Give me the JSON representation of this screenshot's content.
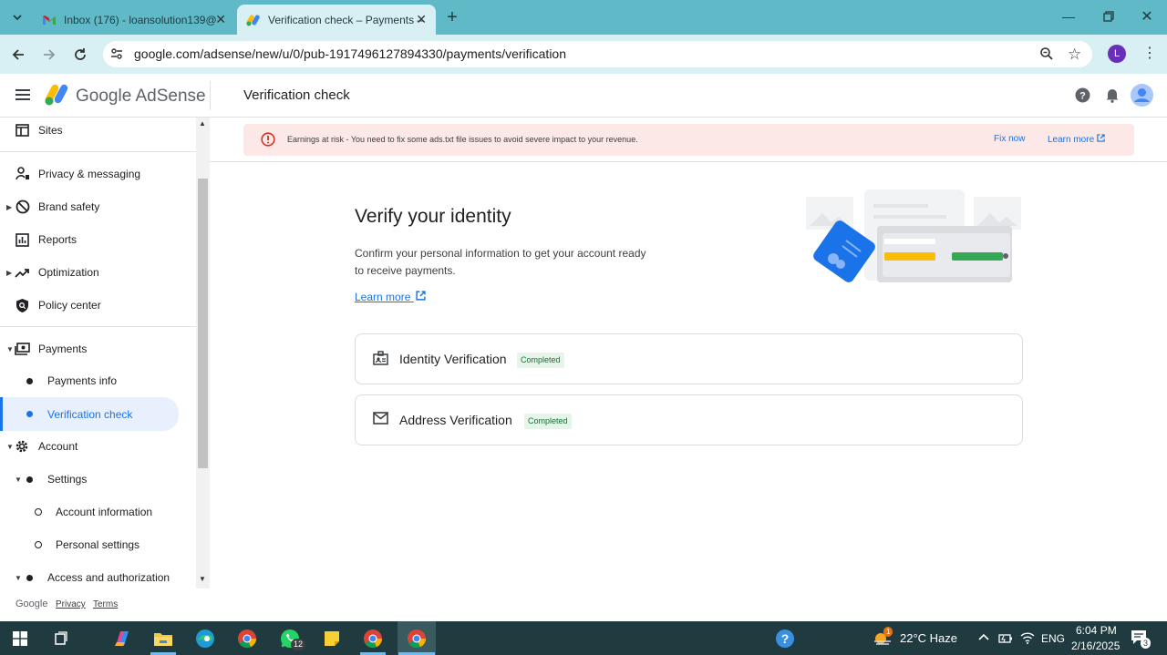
{
  "browser": {
    "tabs": [
      {
        "title": "Inbox (176) - loansolution139@",
        "active": false
      },
      {
        "title": "Verification check – Payments –",
        "active": true
      }
    ],
    "url": "google.com/adsense/new/u/0/pub-1917496127894330/payments/verification",
    "profile_initial": "L"
  },
  "header": {
    "brand": "Google AdSense",
    "page_title": "Verification check"
  },
  "sidebar": {
    "items": [
      {
        "label": "Sites",
        "icon": "sites-icon"
      },
      {
        "label": "Privacy & messaging",
        "icon": "privacy-icon"
      },
      {
        "label": "Brand safety",
        "icon": "block-icon"
      },
      {
        "label": "Reports",
        "icon": "reports-icon"
      },
      {
        "label": "Optimization",
        "icon": "trending-icon"
      },
      {
        "label": "Policy center",
        "icon": "policy-icon"
      },
      {
        "label": "Payments",
        "icon": "payments-icon"
      },
      {
        "label": "Payments info"
      },
      {
        "label": "Verification check"
      },
      {
        "label": "Account",
        "icon": "gear-icon"
      },
      {
        "label": "Settings"
      },
      {
        "label": "Account information"
      },
      {
        "label": "Personal settings"
      },
      {
        "label": "Access and authorization"
      }
    ],
    "footer": {
      "brand": "Google",
      "privacy": "Privacy",
      "terms": "Terms"
    }
  },
  "alert": {
    "text": "Earnings at risk - You need to fix some ads.txt file issues to avoid severe impact to your revenue.",
    "fix_now": "Fix now",
    "learn_more": "Learn more"
  },
  "main": {
    "title": "Verify your identity",
    "description": "Confirm your personal information to get your account ready to receive payments.",
    "learn_more": "Learn more",
    "cards": [
      {
        "title": "Identity Verification",
        "status": "Completed"
      },
      {
        "title": "Address Verification",
        "status": "Completed"
      }
    ]
  },
  "taskbar": {
    "whatsapp_badge": "12",
    "weather": "22°C  Haze",
    "weather_badge": "1",
    "language": "ENG",
    "time": "6:04 PM",
    "date": "2/16/2025",
    "notifications": "3"
  },
  "colors": {
    "accent": "#1a73e8",
    "tabbar": "#5fb9c6",
    "alert_bg": "#fce8e6",
    "badge_bg": "#e6f4ea",
    "taskbar": "#1f3b40"
  }
}
